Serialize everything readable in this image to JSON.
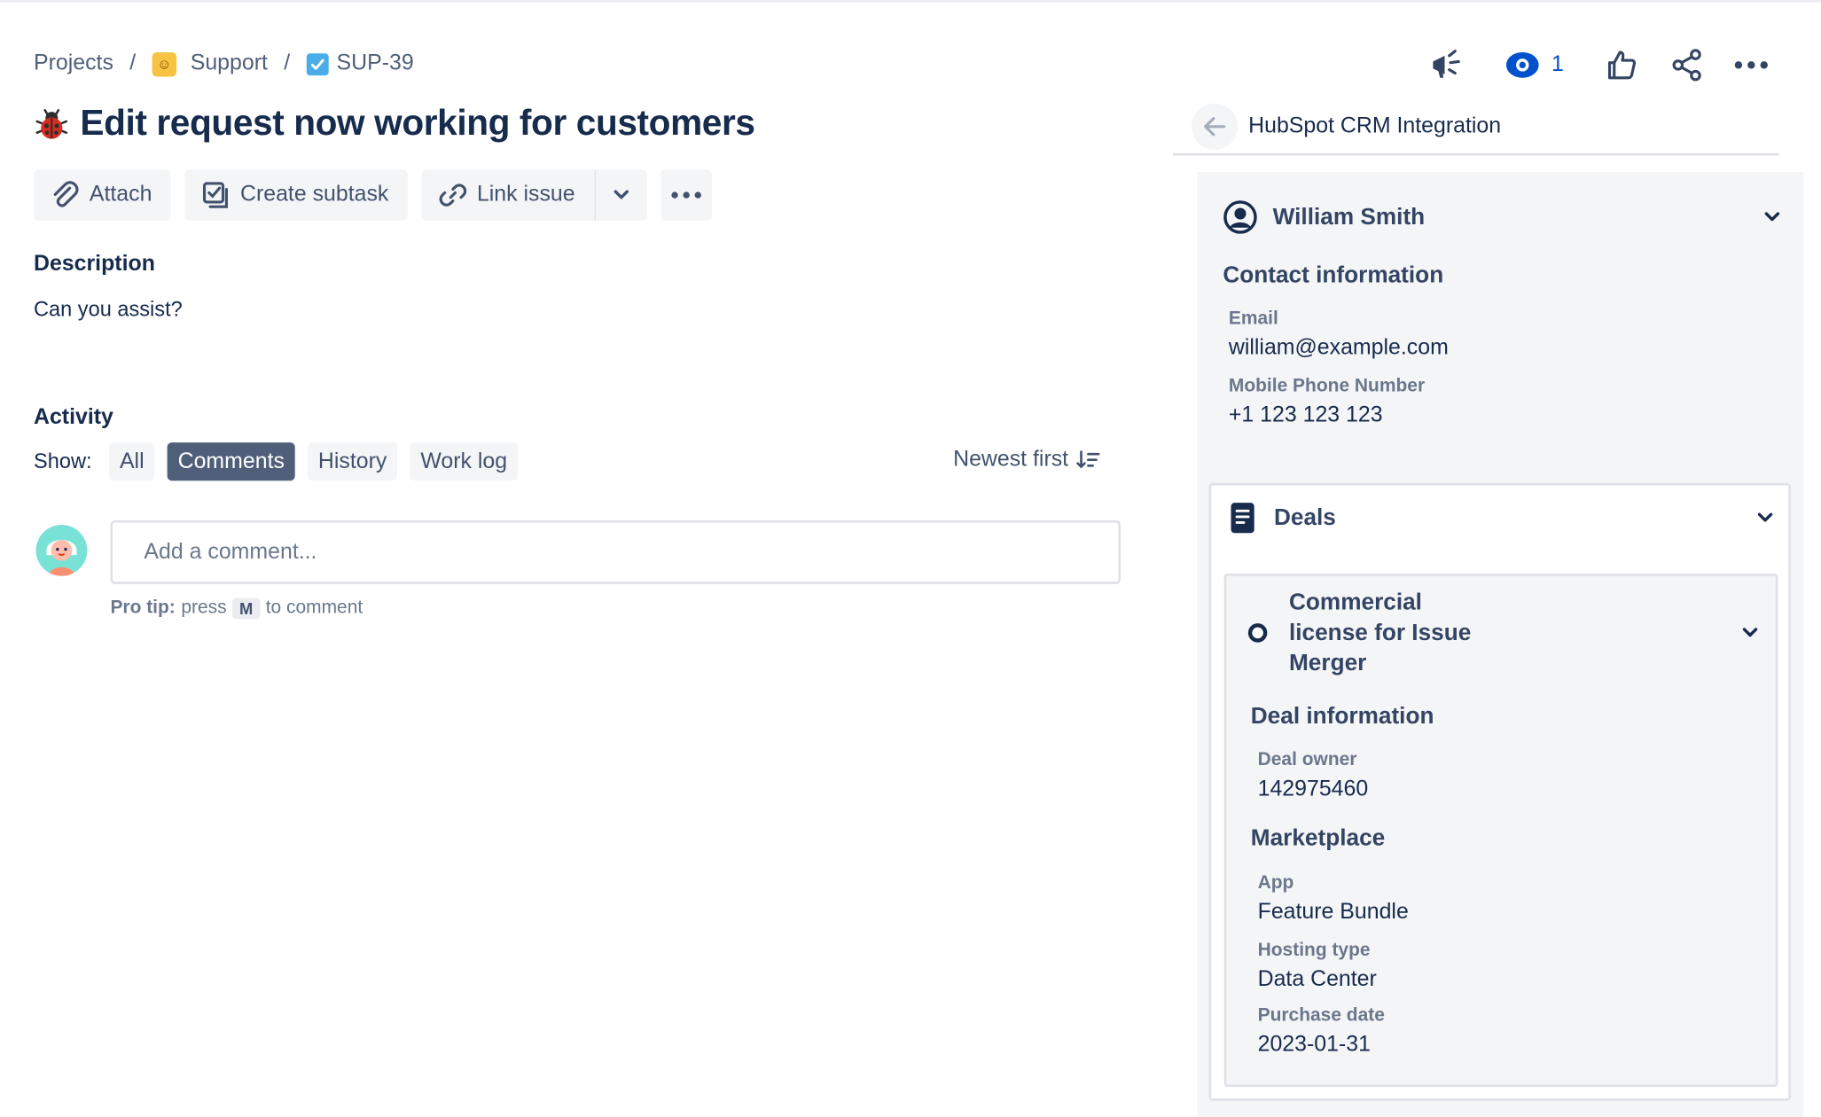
{
  "breadcrumb": {
    "projects": "Projects",
    "separator": "/",
    "project": "Support",
    "issue_key": "SUP-39"
  },
  "issue": {
    "title": "Edit request now working for customers",
    "type_icon": "bug-icon"
  },
  "toolbar": {
    "attach": "Attach",
    "create_subtask": "Create subtask",
    "link_issue": "Link issue"
  },
  "description": {
    "heading": "Description",
    "text": "Can you assist?"
  },
  "activity": {
    "heading": "Activity",
    "show_label": "Show:",
    "filters": [
      "All",
      "Comments",
      "History",
      "Work log"
    ],
    "active_filter": "Comments",
    "sort_label": "Newest first",
    "comment_placeholder": "Add a comment...",
    "protip_bold": "Pro tip:",
    "protip_press": "press",
    "protip_key": "M",
    "protip_rest": "to comment"
  },
  "header_actions": {
    "watch_count": "1"
  },
  "panel": {
    "title": "HubSpot CRM Integration",
    "contact": {
      "name": "William Smith",
      "section": "Contact information",
      "email_label": "Email",
      "email": "william@example.com",
      "phone_label": "Mobile Phone Number",
      "phone": "+1 123 123 123"
    },
    "deals": {
      "heading": "Deals",
      "deal": {
        "name_line1": "Commercial",
        "name_line2": "license for Issue",
        "name_line3": "Merger",
        "info_heading": "Deal information",
        "owner_label": "Deal owner",
        "owner": "142975460",
        "marketplace_heading": "Marketplace",
        "app_label": "App",
        "app": "Feature Bundle",
        "hosting_label": "Hosting type",
        "hosting": "Data Center",
        "purchase_label": "Purchase date",
        "purchase": "2023-01-31"
      }
    }
  },
  "colors": {
    "text": "#172b4d",
    "subtle": "#42526e",
    "active_pill": "#505f79",
    "link_blue": "#0052cc",
    "panel_bg": "#f4f5f7"
  }
}
